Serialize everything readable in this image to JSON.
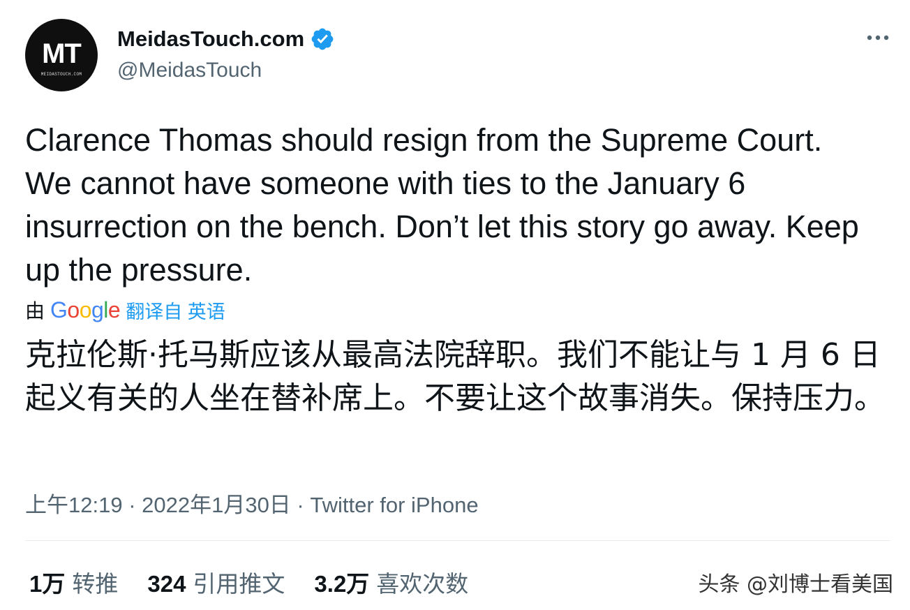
{
  "author": {
    "avatar_monogram": "MT",
    "avatar_subtext": "MEIDASTOUCH.COM",
    "display_name": "MeidasTouch.com",
    "handle": "@MeidasTouch",
    "verified": true
  },
  "icons": {
    "verified": "verified-badge-icon",
    "more": "more-options-icon"
  },
  "tweet": {
    "text": "Clarence Thomas should resign from the Supreme Court. We cannot have someone with ties to the January 6 insurrection on the bench. Don’t let this story go away. Keep up the pressure.",
    "translation_by": "由",
    "translation_provider": "Google",
    "translation_link": "翻译自 英语",
    "translated_text": "克拉伦斯·托马斯应该从最高法院辞职。我们不能让与 1 月 6 日起义有关的人坐在替补席上。不要让这个故事消失。保持压力。"
  },
  "meta": {
    "timestamp": "上午12:19 · 2022年1月30日 · Twitter for iPhone"
  },
  "stats": [
    {
      "num": "1万",
      "label": "转推"
    },
    {
      "num": "324",
      "label": "引用推文"
    },
    {
      "num": "3.2万",
      "label": "喜欢次数"
    }
  ],
  "watermark": "头条 @刘博士看美国",
  "colors": {
    "accent": "#1d9bf0",
    "secondary_text": "#536471",
    "primary_text": "#0f1419"
  }
}
